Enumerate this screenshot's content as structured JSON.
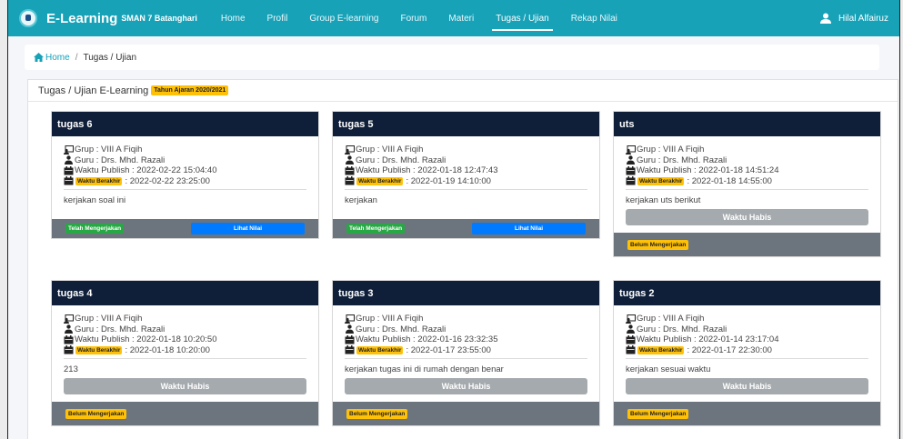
{
  "navbar": {
    "brand_title": "E-Learning",
    "brand_subtitle": "SMAN 7 Batanghari",
    "items": [
      {
        "label": "Home",
        "active": false
      },
      {
        "label": "Profil",
        "active": false
      },
      {
        "label": "Group E-learning",
        "active": false
      },
      {
        "label": "Forum",
        "active": false
      },
      {
        "label": "Materi",
        "active": false
      },
      {
        "label": "Tugas / Ujian",
        "active": true
      },
      {
        "label": "Rekap Nilai",
        "active": false
      }
    ],
    "user_name": "Hilal Alfairuz",
    "colors": {
      "bg": "#17a2b8"
    }
  },
  "breadcrumb": {
    "home": "Home",
    "separator": "/",
    "current": "Tugas / Ujian"
  },
  "panel": {
    "title": "Tugas / Ujian E-Learning",
    "year_badge": "Tahun Ajaran 2020/2021"
  },
  "labels": {
    "grup": "Grup : VIII A Fiqih",
    "guru": "Guru : Drs. Mhd. Razali",
    "waktu_publish_prefix": "Waktu Publish : ",
    "waktu_berakhir": "Waktu Berakhir",
    "lihat_nilai": "Lihat Nilai",
    "waktu_habis": "Waktu Habis",
    "telah": "Telah Mengerjakan",
    "belum": "Belum Mengerjakan"
  },
  "cards": [
    {
      "title": "tugas 6",
      "publish": "Waktu Publish : 2022-02-22 15:04:40",
      "end": ": 2022-02-22 23:25:00",
      "desc": "kerjakan soal ini",
      "status": "done"
    },
    {
      "title": "tugas 5",
      "publish": "Waktu Publish : 2022-01-18 12:47:43",
      "end": ": 2022-01-19 14:10:00",
      "desc": "kerjakan",
      "status": "done"
    },
    {
      "title": "uts",
      "publish": "Waktu Publish : 2022-01-18 14:51:24",
      "end": ": 2022-01-18 14:55:00",
      "desc": "kerjakan uts berikut",
      "status": "expired"
    },
    {
      "title": "tugas 4",
      "publish": "Waktu Publish : 2022-01-18 10:20:50",
      "end": ": 2022-01-18 10:20:00",
      "desc": "213",
      "status": "expired"
    },
    {
      "title": "tugas 3",
      "publish": "Waktu Publish : 2022-01-16 23:32:35",
      "end": ": 2022-01-17 23:55:00",
      "desc": "kerjakan tugas ini di rumah dengan benar",
      "status": "expired"
    },
    {
      "title": "tugas 2",
      "publish": "Waktu Publish : 2022-01-14 23:17:04",
      "end": ": 2022-01-17 22:30:00",
      "desc": "kerjakan sesuai waktu",
      "status": "expired"
    }
  ]
}
